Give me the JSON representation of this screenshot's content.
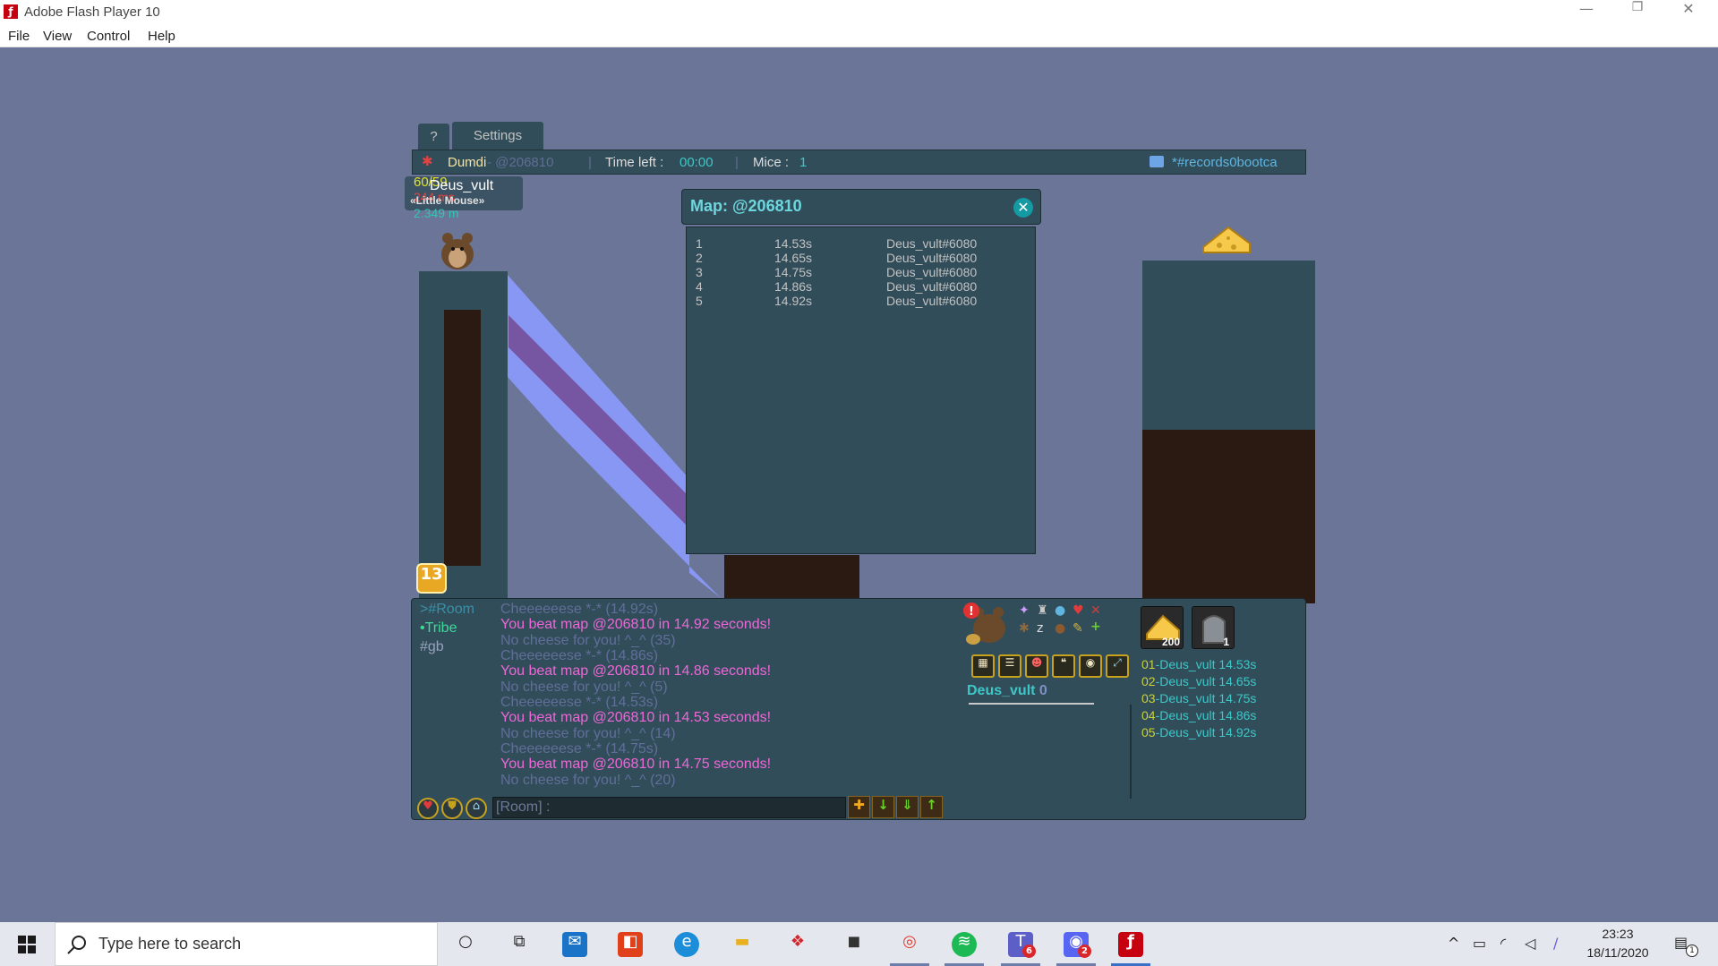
{
  "window": {
    "title": "Adobe Flash Player 10",
    "minimize": "—",
    "maximize": "❐",
    "close": "✕"
  },
  "menu": [
    "File",
    "View",
    "Control",
    "Help"
  ],
  "tabs": {
    "help": "?",
    "settings": "Settings"
  },
  "hud": {
    "map_author": "Dumdi",
    "map_code": " - @206810",
    "time_label": "Time left :",
    "time_value": "00:00",
    "mice_label": "Mice :",
    "mice_value": "1",
    "room_name": "*#records0bootca"
  },
  "player": {
    "fps": "60/59",
    "ping": "244 ms",
    "name": "Deus_vult",
    "title": "«Little Mouse»",
    "distance": "2.349 m",
    "level": "13"
  },
  "map_dialog": {
    "title": "Map: @206810",
    "close": "✕",
    "records": [
      {
        "rank": "1",
        "time": "14.53s",
        "player": "Deus_vult#6080"
      },
      {
        "rank": "2",
        "time": "14.65s",
        "player": "Deus_vult#6080"
      },
      {
        "rank": "3",
        "time": "14.75s",
        "player": "Deus_vult#6080"
      },
      {
        "rank": "4",
        "time": "14.86s",
        "player": "Deus_vult#6080"
      },
      {
        "rank": "5",
        "time": "14.92s",
        "player": "Deus_vult#6080"
      }
    ]
  },
  "chat": {
    "channels": [
      {
        "label": ">#Room",
        "color": "#3a8fa6"
      },
      {
        "label": "•Tribe",
        "color": "#3ddb9a"
      },
      {
        "label": "#gb",
        "color": "#97a2bd"
      }
    ],
    "messages": [
      {
        "text": "Cheeeeeese *-* (14.92s)",
        "type": "cheese"
      },
      {
        "text": "You beat map @206810 in 14.92 seconds!",
        "type": "beat"
      },
      {
        "text": "No cheese for you! ^_^ (35)",
        "type": "cheese"
      },
      {
        "text": "Cheeeeeese *-* (14.86s)",
        "type": "cheese"
      },
      {
        "text": "You beat map @206810 in 14.86 seconds!",
        "type": "beat"
      },
      {
        "text": "No cheese for you! ^_^ (5)",
        "type": "cheese"
      },
      {
        "text": "Cheeeeeese *-* (14.53s)",
        "type": "cheese"
      },
      {
        "text": "You beat map @206810 in 14.53 seconds!",
        "type": "beat"
      },
      {
        "text": "No cheese for you! ^_^ (14)",
        "type": "cheese"
      },
      {
        "text": "Cheeeeeese *-* (14.75s)",
        "type": "cheese"
      },
      {
        "text": "You beat map @206810 in 14.75 seconds!",
        "type": "beat"
      },
      {
        "text": "No cheese for you! ^_^ (20)",
        "type": "cheese"
      }
    ],
    "input_prefix": "[Room] :"
  },
  "side": {
    "player_label": "Deus_vult",
    "player_score": "0",
    "cheese_count": "200",
    "tomb_count": "1",
    "leaderboard": [
      {
        "pos": "01",
        "text": "-Deus_vult 14.53s"
      },
      {
        "pos": "02",
        "text": "-Deus_vult 14.65s"
      },
      {
        "pos": "03",
        "text": "-Deus_vult 14.75s"
      },
      {
        "pos": "04",
        "text": "-Deus_vult 14.86s"
      },
      {
        "pos": "05",
        "text": "-Deus_vult 14.92s"
      }
    ]
  },
  "taskbar": {
    "search_placeholder": "Type here to search",
    "teams_badge": "6",
    "discord_badge": "2",
    "time": "23:23",
    "date": "18/11/2020",
    "notification_count": "1"
  },
  "colors": {
    "stage_bg": "#6a7597",
    "panel": "#324d5a",
    "accent_cyan": "#6ed7de",
    "beat_pink": "#ee67d8",
    "dirt": "#2b1a12"
  }
}
